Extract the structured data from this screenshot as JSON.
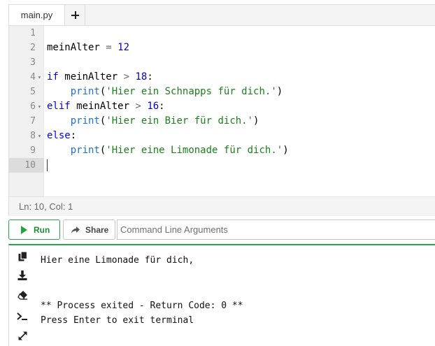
{
  "editor": {
    "tabs": [
      {
        "label": "main.py",
        "active": true
      }
    ],
    "add_tab_icon": "plus-icon",
    "active_line": 10,
    "lines": [
      {
        "number": "1",
        "fold": false,
        "tokens": []
      },
      {
        "number": "2",
        "fold": false,
        "tokens": [
          {
            "text": "meinAlter",
            "type": "plain"
          },
          {
            "text": " ",
            "type": "plain"
          },
          {
            "text": "=",
            "type": "op"
          },
          {
            "text": " ",
            "type": "plain"
          },
          {
            "text": "12",
            "type": "num"
          }
        ]
      },
      {
        "number": "3",
        "fold": false,
        "tokens": []
      },
      {
        "number": "4",
        "fold": true,
        "tokens": [
          {
            "text": "if",
            "type": "kw"
          },
          {
            "text": " meinAlter ",
            "type": "plain"
          },
          {
            "text": ">",
            "type": "op"
          },
          {
            "text": " ",
            "type": "plain"
          },
          {
            "text": "18",
            "type": "num"
          },
          {
            "text": ":",
            "type": "plain"
          }
        ]
      },
      {
        "number": "5",
        "fold": false,
        "tokens": [
          {
            "text": "    ",
            "type": "plain"
          },
          {
            "text": "print",
            "type": "fn"
          },
          {
            "text": "(",
            "type": "plain"
          },
          {
            "text": "'Hier ein Schnapps für dich.'",
            "type": "str"
          },
          {
            "text": ")",
            "type": "plain"
          }
        ]
      },
      {
        "number": "6",
        "fold": true,
        "tokens": [
          {
            "text": "elif",
            "type": "kw"
          },
          {
            "text": " meinAlter ",
            "type": "plain"
          },
          {
            "text": ">",
            "type": "op"
          },
          {
            "text": " ",
            "type": "plain"
          },
          {
            "text": "16",
            "type": "num"
          },
          {
            "text": ":",
            "type": "plain"
          }
        ]
      },
      {
        "number": "7",
        "fold": false,
        "tokens": [
          {
            "text": "    ",
            "type": "plain"
          },
          {
            "text": "print",
            "type": "fn"
          },
          {
            "text": "(",
            "type": "plain"
          },
          {
            "text": "'Hier ein Bier für dich.'",
            "type": "str"
          },
          {
            "text": ")",
            "type": "plain"
          }
        ]
      },
      {
        "number": "8",
        "fold": true,
        "tokens": [
          {
            "text": "else",
            "type": "kw"
          },
          {
            "text": ":",
            "type": "plain"
          }
        ]
      },
      {
        "number": "9",
        "fold": false,
        "tokens": [
          {
            "text": "    ",
            "type": "plain"
          },
          {
            "text": "print",
            "type": "fn"
          },
          {
            "text": "(",
            "type": "plain"
          },
          {
            "text": "'Hier eine Limonade für dich.'",
            "type": "str"
          },
          {
            "text": ")",
            "type": "plain"
          }
        ]
      },
      {
        "number": "10",
        "fold": false,
        "tokens": []
      }
    ],
    "status": "Ln: 10,  Col: 1"
  },
  "toolbar": {
    "run_label": "Run",
    "share_label": "Share",
    "args_placeholder": "Command Line Arguments"
  },
  "terminal": {
    "icons": [
      "copy-icon",
      "download-icon",
      "eraser-icon",
      "terminal-prompt-icon",
      "expand-icon"
    ],
    "output_lines": [
      "Hier eine Limonade für dich,",
      "",
      "",
      "** Process exited - Return Code: 0 **",
      "Press Enter to exit terminal"
    ]
  },
  "colors": {
    "run_green": "#22a33b",
    "terminal_accent": "#28a745",
    "keyword": "#0000ff",
    "string": "#1a7f1a",
    "builtin": "#1e6fd9",
    "number": "#0000cd"
  }
}
